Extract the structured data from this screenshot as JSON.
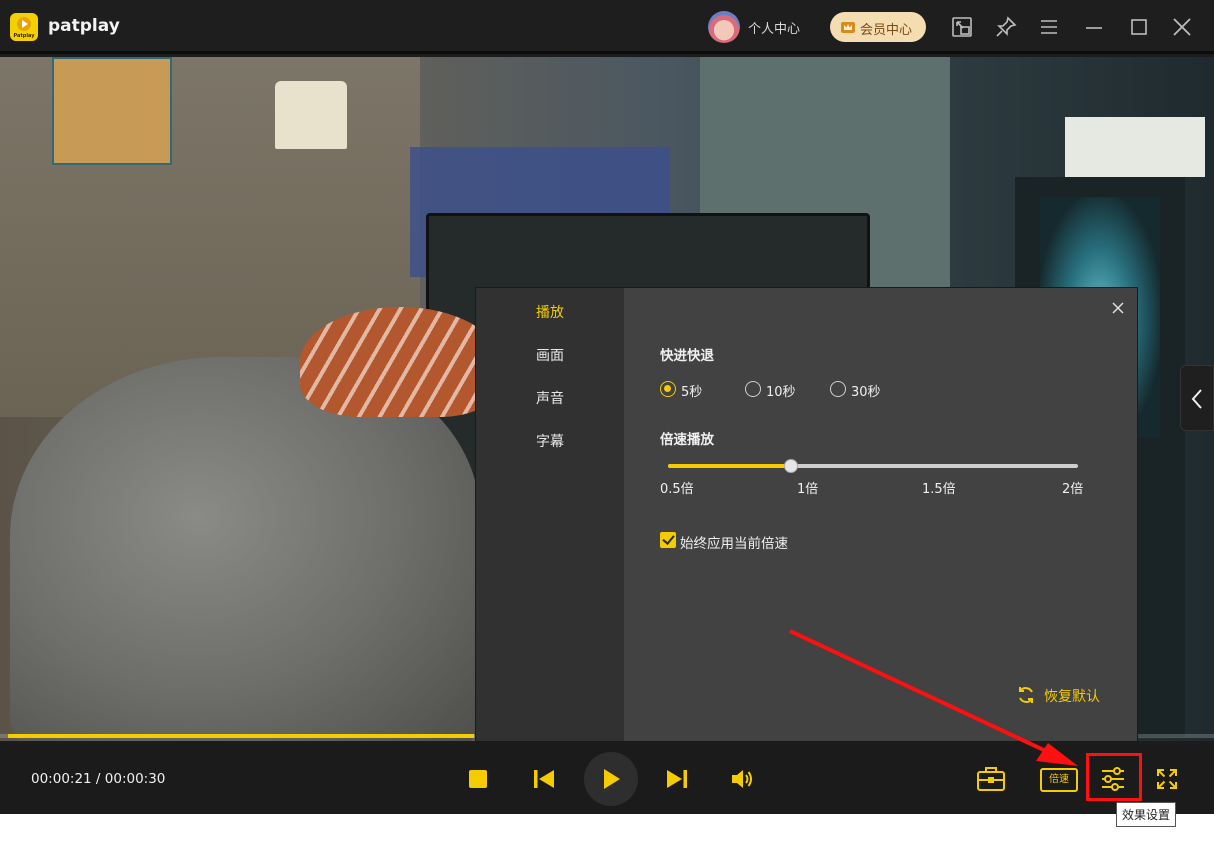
{
  "app": {
    "title": "patplay",
    "logo_text": "Patplay"
  },
  "header": {
    "user_center": "个人中心",
    "vip_center": "会员中心"
  },
  "player": {
    "current_time": "00:00:21",
    "total_time": "00:00:30",
    "time_display": "00:00:21 / 00:00:30",
    "progress": 0.7,
    "speed_button": "倍速"
  },
  "settings": {
    "nav": [
      {
        "label": "播放",
        "active": true
      },
      {
        "label": "画面",
        "active": false
      },
      {
        "label": "声音",
        "active": false
      },
      {
        "label": "字幕",
        "active": false
      }
    ],
    "seek": {
      "title": "快进快退",
      "options": [
        "5秒",
        "10秒",
        "30秒"
      ],
      "selected": "5秒"
    },
    "speed": {
      "title": "倍速播放",
      "ticks": [
        "0.5倍",
        "1倍",
        "1.5倍",
        "2倍"
      ],
      "value": 1.0,
      "min": 0.5,
      "max": 2.0
    },
    "always_apply": {
      "label": "始终应用当前倍速",
      "checked": true
    },
    "restore_default": "恢复默认"
  },
  "tooltip": "效果设置",
  "colors": {
    "accent": "#f5cc00",
    "highlight": "#ff1010",
    "panel": "#424242"
  }
}
